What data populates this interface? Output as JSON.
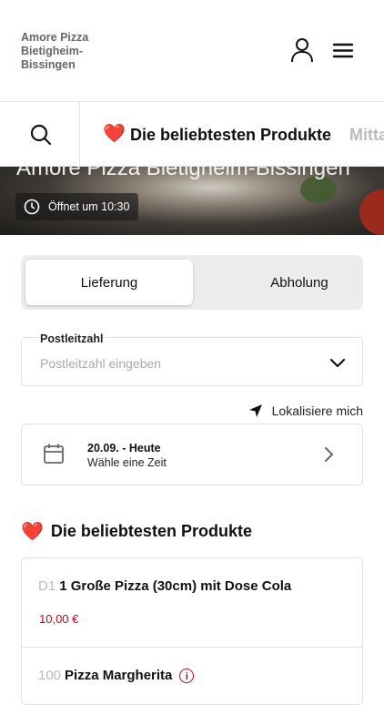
{
  "header": {
    "brand_line1": "Amore Pizza",
    "brand_line2": "Bietigheim-",
    "brand_line3": "Bissingen",
    "account_icon": "user-icon",
    "menu_icon": "hamburger-menu-icon"
  },
  "category_bar": {
    "search_icon": "search-icon",
    "active_emoji": "❤️",
    "active_label": "Die beliebtesten Produkte",
    "next_label": "Mitta"
  },
  "hero": {
    "title": "Amore Pizza Bietigheim-Bissingen",
    "hours": "Öffnet um 10:30"
  },
  "order_mode": {
    "delivery_label": "Lieferung",
    "pickup_label": "Abholung",
    "selected": "Lieferung"
  },
  "postcode": {
    "label": "Postleitzahl",
    "placeholder": "Postleitzahl eingeben",
    "value": ""
  },
  "locate_label": "Lokalisiere mich",
  "date_picker": {
    "date": "20.09. - Heute",
    "hint": "Wähle eine Zeit"
  },
  "popular_section": {
    "emoji": "❤️",
    "title": "Die beliebtesten Produkte",
    "products": [
      {
        "code": "D1",
        "name": "1 Große Pizza (30cm) mit Dose Cola",
        "price": "10,00 €"
      },
      {
        "code": "100",
        "name": "Pizza Margherita",
        "price": ""
      }
    ]
  },
  "colors": {
    "accent_red": "#d0021b",
    "border": "#e2e2e2",
    "muted": "#bbbbbb"
  }
}
